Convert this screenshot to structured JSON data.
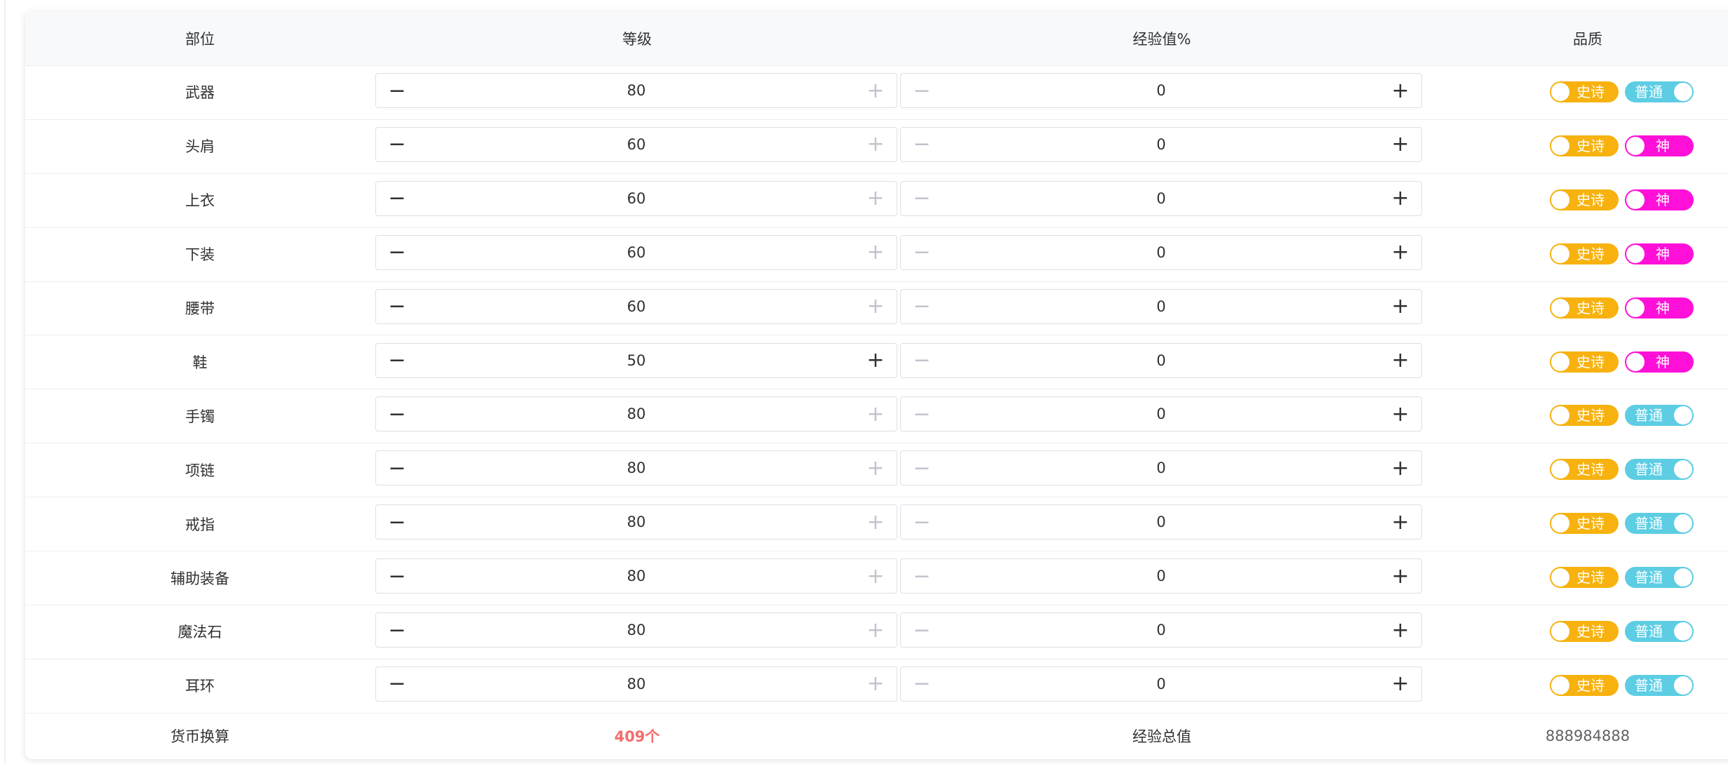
{
  "table": {
    "headers": {
      "part": "部位",
      "level": "等级",
      "exp": "经验值%",
      "quality": "品质"
    },
    "rows": [
      {
        "part": "武器",
        "level": "80",
        "exp": "0",
        "q1": "史诗",
        "q2": "普通",
        "q2_type": "normal",
        "level_plus_enabled": false
      },
      {
        "part": "头肩",
        "level": "60",
        "exp": "0",
        "q1": "史诗",
        "q2": "神",
        "q2_type": "god",
        "level_plus_enabled": false
      },
      {
        "part": "上衣",
        "level": "60",
        "exp": "0",
        "q1": "史诗",
        "q2": "神",
        "q2_type": "god",
        "level_plus_enabled": false
      },
      {
        "part": "下装",
        "level": "60",
        "exp": "0",
        "q1": "史诗",
        "q2": "神",
        "q2_type": "god",
        "level_plus_enabled": false
      },
      {
        "part": "腰带",
        "level": "60",
        "exp": "0",
        "q1": "史诗",
        "q2": "神",
        "q2_type": "god",
        "level_plus_enabled": false
      },
      {
        "part": "鞋",
        "level": "50",
        "exp": "0",
        "q1": "史诗",
        "q2": "神",
        "q2_type": "god",
        "level_plus_enabled": true
      },
      {
        "part": "手镯",
        "level": "80",
        "exp": "0",
        "q1": "史诗",
        "q2": "普通",
        "q2_type": "normal",
        "level_plus_enabled": false
      },
      {
        "part": "项链",
        "level": "80",
        "exp": "0",
        "q1": "史诗",
        "q2": "普通",
        "q2_type": "normal",
        "level_plus_enabled": false
      },
      {
        "part": "戒指",
        "level": "80",
        "exp": "0",
        "q1": "史诗",
        "q2": "普通",
        "q2_type": "normal",
        "level_plus_enabled": false
      },
      {
        "part": "辅助装备",
        "level": "80",
        "exp": "0",
        "q1": "史诗",
        "q2": "普通",
        "q2_type": "normal",
        "level_plus_enabled": false
      },
      {
        "part": "魔法石",
        "level": "80",
        "exp": "0",
        "q1": "史诗",
        "q2": "普通",
        "q2_type": "normal",
        "level_plus_enabled": false
      },
      {
        "part": "耳环",
        "level": "80",
        "exp": "0",
        "q1": "史诗",
        "q2": "普通",
        "q2_type": "normal",
        "level_plus_enabled": false
      }
    ],
    "footer": {
      "currency_label": "货币换算",
      "currency_value": "409个",
      "exp_total_label": "经验总值",
      "exp_total_value": "888984888"
    }
  },
  "glyphs": {
    "minus": "−",
    "plus": "+"
  },
  "colors": {
    "epic": "#f7b20f",
    "god": "#ff10d8",
    "normal": "#5ccde3",
    "currency": "#f56c6c"
  },
  "icons": {
    "minus": "minus-icon",
    "plus": "plus-icon"
  }
}
